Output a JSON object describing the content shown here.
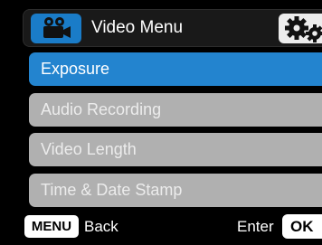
{
  "header": {
    "title": "Video Menu",
    "active_tab_icon": "video-camera-icon",
    "settings_tab_icon": "gears-icon"
  },
  "menu": {
    "items": [
      {
        "label": "Exposure",
        "selected": true
      },
      {
        "label": "Audio Recording",
        "selected": false
      },
      {
        "label": "Video Length",
        "selected": false
      },
      {
        "label": "Time & Date Stamp",
        "selected": false
      }
    ]
  },
  "footer": {
    "menu_key": "MENU",
    "back_label": "Back",
    "enter_label": "Enter",
    "ok_key": "OK"
  },
  "colors": {
    "accent_blue": "#2384cf",
    "item_grey": "#b0b0b0",
    "background": "#000000"
  }
}
